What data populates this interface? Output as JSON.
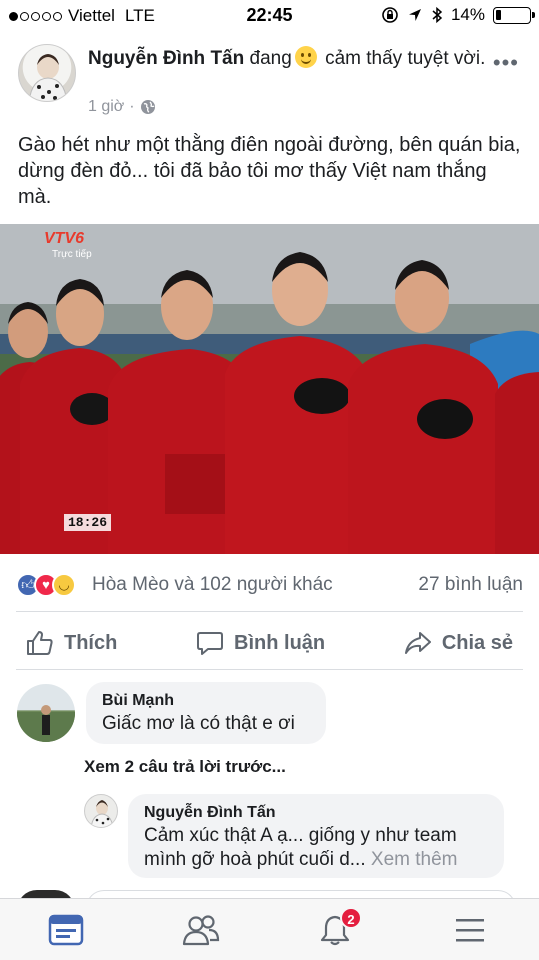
{
  "status_bar": {
    "carrier": "Viettel",
    "network": "LTE",
    "time": "22:45",
    "battery": "14%"
  },
  "post": {
    "author": "Nguyễn Đình Tấn",
    "feeling_prefix": "đang",
    "feeling_text": "cảm thấy tuyệt vời.",
    "time": "1 giờ",
    "text": "Gào hét như một thằng điên ngoài đường, bên quán bia, dừng đèn đỏ... tôi đã bảo tôi mơ thấy Việt nam thắng mà.",
    "photo": {
      "channel_logo": "VTV6",
      "channel_sub": "Trực tiếp",
      "clock": "18:26"
    }
  },
  "reactions": {
    "names": "Hòa Mèo và 102 người khác",
    "comment_count": "27 bình luận"
  },
  "actions": {
    "like": "Thích",
    "comment": "Bình luận",
    "share": "Chia sẻ"
  },
  "comments": [
    {
      "name": "Bùi Mạnh",
      "text": "Giấc mơ là có thật e ơi"
    }
  ],
  "view_previous_replies": "Xem 2 câu trả lời trước...",
  "reply": {
    "name": "Nguyễn Đình Tấn",
    "text_line1": "Cảm xúc thật A ạ... giống y như team",
    "text_line2": "mình gỡ hoà phút cuối d...",
    "see_more": "Xem thêm"
  },
  "tab_bar": {
    "notification_badge": "2"
  },
  "colors": {
    "accent": "#4267b2",
    "secondary_text": "#606770",
    "badge": "#e41e3f"
  }
}
